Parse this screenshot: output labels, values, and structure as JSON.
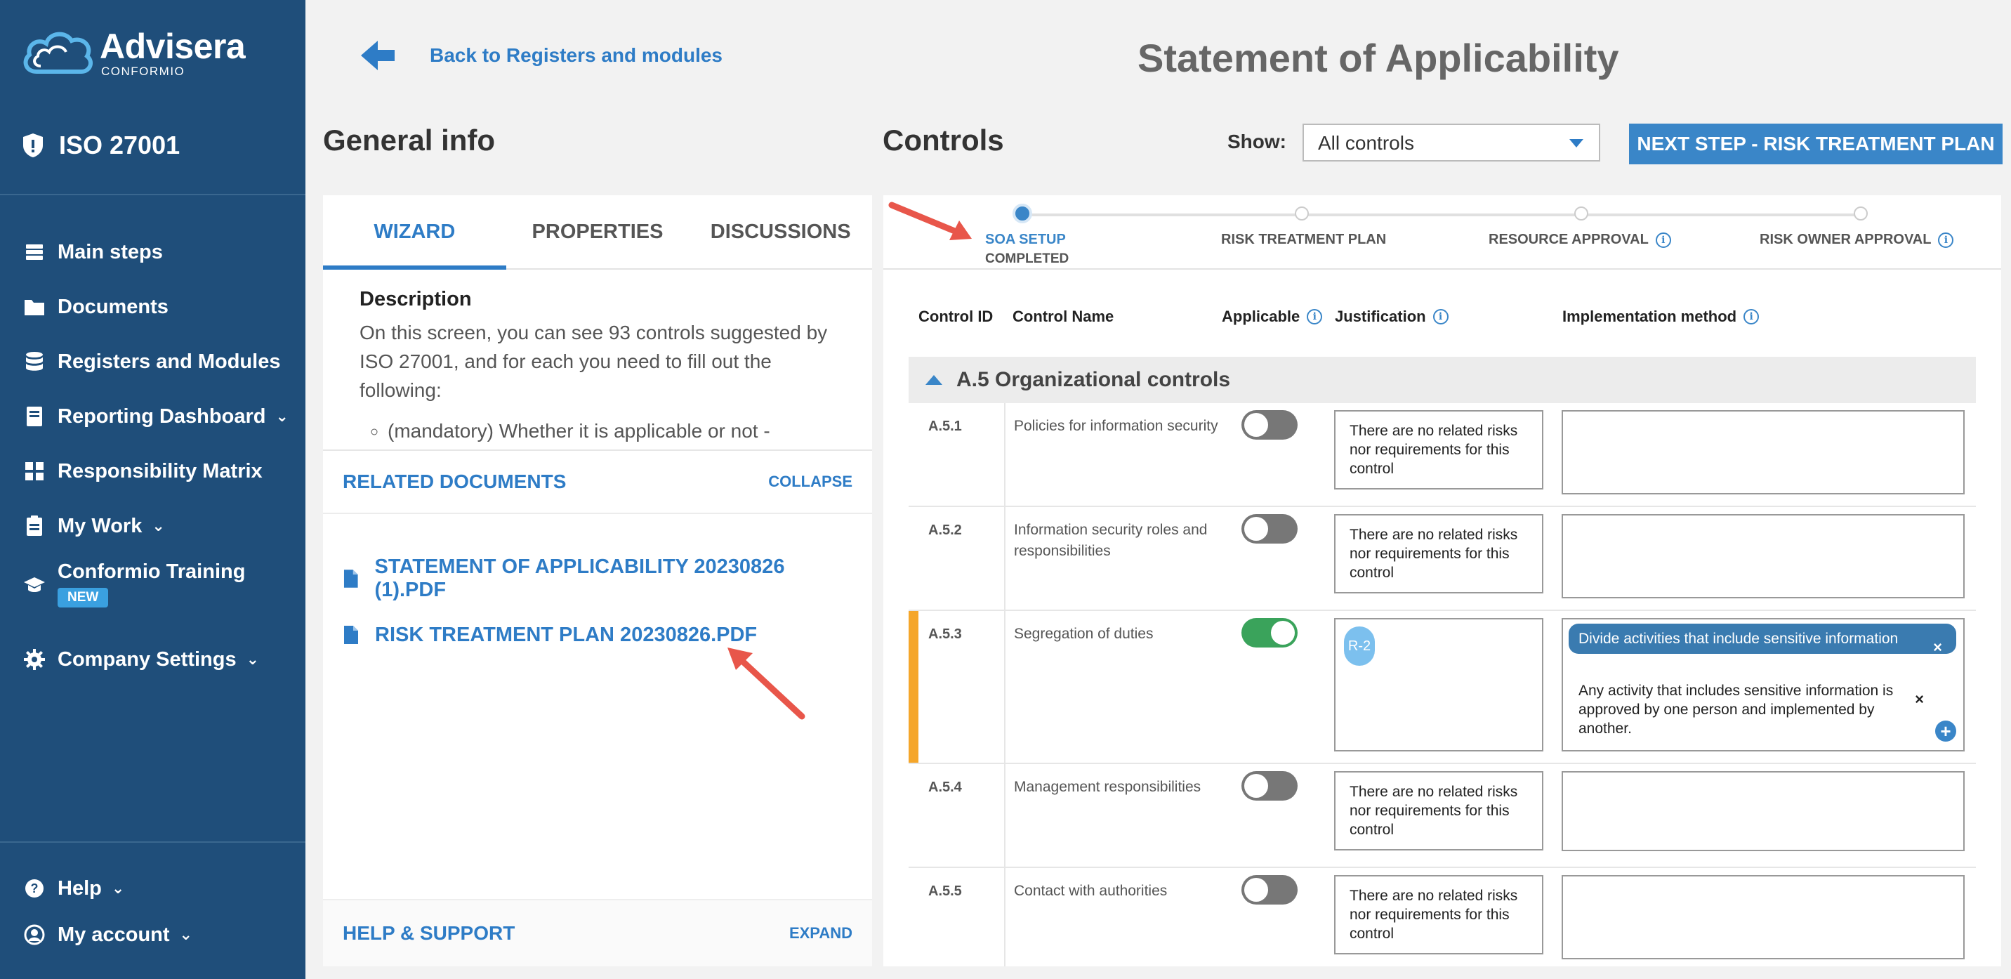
{
  "brand": {
    "name": "Advisera",
    "sub": "CONFORMIO"
  },
  "standard": "ISO 27001",
  "nav": {
    "main_steps": "Main steps",
    "documents": "Documents",
    "registers": "Registers and Modules",
    "reporting": "Reporting Dashboard",
    "responsibility": "Responsibility Matrix",
    "my_work": "My Work",
    "training": "Conformio Training",
    "training_badge": "NEW",
    "company": "Company Settings",
    "help": "Help",
    "account": "My account"
  },
  "header": {
    "back": "Back to Registers and modules",
    "title": "Statement of Applicability",
    "general_info": "General info",
    "controls": "Controls",
    "show_label": "Show:",
    "show_value": "All controls",
    "next_button": "NEXT STEP - RISK TREATMENT PLAN"
  },
  "left": {
    "tabs": [
      "WIZARD",
      "PROPERTIES",
      "DISCUSSIONS"
    ],
    "desc_title": "Description",
    "desc_text": "On this screen, you can see 93 controls suggested by ISO 27001, and for each you need to fill out the following:",
    "desc_bullet": "(mandatory) Whether it is applicable or not -",
    "related_title": "RELATED DOCUMENTS",
    "related_action": "COLLAPSE",
    "docs": [
      "STATEMENT OF APPLICABILITY 20230826 (1).PDF",
      "RISK TREATMENT PLAN 20230826.PDF"
    ],
    "help_title": "HELP & SUPPORT",
    "help_action": "EXPAND"
  },
  "stepper": {
    "steps": [
      "SOA SETUP",
      "RISK TREATMENT PLAN",
      "RESOURCE APPROVAL",
      "RISK OWNER APPROVAL"
    ],
    "active_sub": "COMPLETED"
  },
  "table": {
    "headers": {
      "id": "Control ID",
      "name": "Control Name",
      "applicable": "Applicable",
      "justification": "Justification",
      "implementation": "Implementation method"
    },
    "group": "A.5 Organizational controls",
    "no_risk_text": "There are no related risks nor requirements for this control",
    "rows": [
      {
        "id": "A.5.1",
        "name": "Policies for information security",
        "applicable": false
      },
      {
        "id": "A.5.2",
        "name": "Information security roles and responsibilities",
        "applicable": false
      },
      {
        "id": "A.5.3",
        "name": "Segregation of duties",
        "applicable": true
      },
      {
        "id": "A.5.4",
        "name": "Management responsibilities",
        "applicable": false
      },
      {
        "id": "A.5.5",
        "name": "Contact with authorities",
        "applicable": false
      }
    ],
    "a53_chip": "R-2",
    "a53_impl_chip": "Divide activities that include sensitive information",
    "a53_impl_text": "Any activity that includes sensitive information is approved by one person and implemented by another.",
    "close_glyph": "×",
    "add_glyph": "+"
  },
  "colors": {
    "sidebar": "#1f4e7a",
    "accent": "#2e7cc6",
    "toggle_on": "#3aa35b",
    "row_marker": "#f5a62a",
    "annotation": "#e8564a"
  }
}
